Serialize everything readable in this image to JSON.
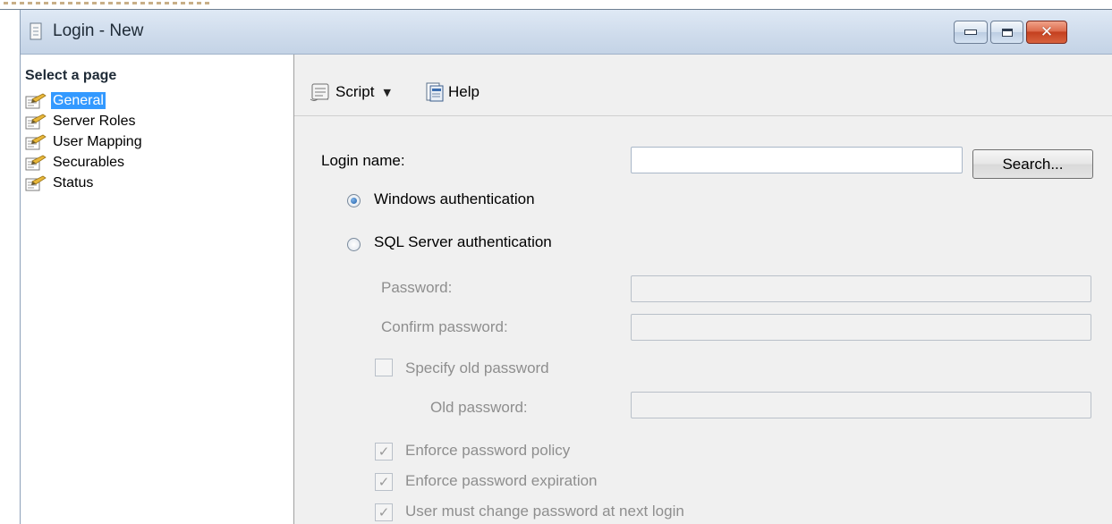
{
  "window": {
    "title": "Login - New",
    "minimize_icon": "minimize-icon",
    "maximize_icon": "maximize-icon",
    "close_icon": "close-icon",
    "close_glyph": "✕"
  },
  "left_panel": {
    "header": "Select a page",
    "items": [
      {
        "label": "General",
        "selected": true,
        "icon": "page-icon"
      },
      {
        "label": "Server Roles",
        "selected": false,
        "icon": "page-icon"
      },
      {
        "label": "User Mapping",
        "selected": false,
        "icon": "page-icon"
      },
      {
        "label": "Securables",
        "selected": false,
        "icon": "page-icon"
      },
      {
        "label": "Status",
        "selected": false,
        "icon": "page-icon"
      }
    ]
  },
  "toolbar": {
    "script_label": "Script",
    "script_dropdown_glyph": "▼",
    "help_label": "Help"
  },
  "form": {
    "login_name_label": "Login name:",
    "login_name_value": "",
    "search_button": "Search...",
    "windows_auth_label": "Windows authentication",
    "windows_auth_selected": true,
    "sql_auth_label": "SQL Server authentication",
    "sql_auth_selected": false,
    "password_label": "Password:",
    "password_value": "",
    "confirm_password_label": "Confirm password:",
    "confirm_password_value": "",
    "specify_old_password_label": "Specify old password",
    "specify_old_password_checked": false,
    "old_password_label": "Old password:",
    "old_password_value": "",
    "enforce_policy_label": "Enforce password policy",
    "enforce_policy_checked": true,
    "enforce_expiration_label": "Enforce password expiration",
    "enforce_expiration_checked": true,
    "must_change_label": "User must change password at next login",
    "must_change_checked": true,
    "check_glyph": "✓"
  },
  "colors": {
    "selection": "#3399ff",
    "titlebar": "#cfdcec",
    "disabled_text": "#8e8e8e",
    "close_button": "#c4401f"
  }
}
